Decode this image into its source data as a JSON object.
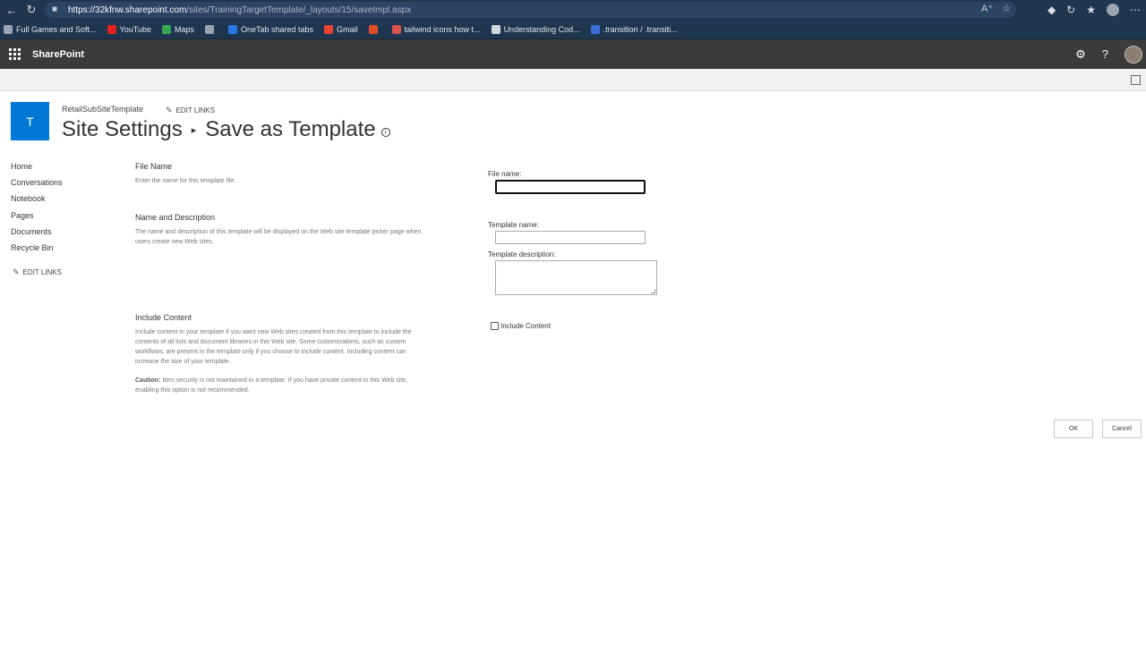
{
  "browser": {
    "url_host": "https://32kfnw.sharepoint.com",
    "url_path": "/sites/TrainingTargetTemplate/_layouts/15/savetmpl.aspx",
    "bookmarks": [
      {
        "label": "Full Games and Soft...",
        "color": "#9aa4b0"
      },
      {
        "label": "YouTube",
        "color": "#e02020"
      },
      {
        "label": "Maps",
        "color": "#34a853"
      },
      {
        "label": "",
        "color": "#9aa4b0"
      },
      {
        "label": "OneTab shared tabs",
        "color": "#2b78e4"
      },
      {
        "label": "Gmail",
        "color": "#ea4335"
      },
      {
        "label": "",
        "color": "#e34c26"
      },
      {
        "label": "tailwind icons how t...",
        "color": "#d9534f"
      },
      {
        "label": "Understanding Cod...",
        "color": "#cfd6de"
      },
      {
        "label": ".transition / .transiti...",
        "color": "#3b6fd8"
      }
    ]
  },
  "suite": {
    "brand": "SharePoint"
  },
  "site": {
    "logo_letter": "T",
    "name": "RetailSubSiteTemplate",
    "edit_links": "EDIT LINKS",
    "title_part1": "Site Settings",
    "title_separator": "▸",
    "title_part2": "Save as Template"
  },
  "leftnav": {
    "items": [
      "Home",
      "Conversations",
      "Notebook",
      "Pages",
      "Documents",
      "Recycle Bin"
    ],
    "edit_links": "EDIT LINKS"
  },
  "form": {
    "file_section": {
      "title": "File Name",
      "desc": "Enter the name for this template file.",
      "field_label": "File name:",
      "value": ""
    },
    "name_section": {
      "title": "Name and Description",
      "desc": "The name and description of this template will be displayed on the Web site template picker page when users create new Web sites.",
      "template_name_label": "Template name:",
      "template_name_value": "",
      "template_desc_label": "Template description:",
      "template_desc_value": ""
    },
    "content_section": {
      "title": "Include Content",
      "desc": "Include content in your template if you want new Web sites created from this template to include the contents of all lists and document libraries in this Web site. Some customizations, such as custom workflows, are present in the template only if you choose to include content. Including content can increase the size of your template.",
      "caution_label": "Caution:",
      "caution_text": "Item security is not maintained in a template. If you have private content in this Web site, enabling this option is not recommended.",
      "checkbox_label": "Include Content",
      "checked": false
    },
    "ok_label": "OK",
    "cancel_label": "Cancel"
  }
}
